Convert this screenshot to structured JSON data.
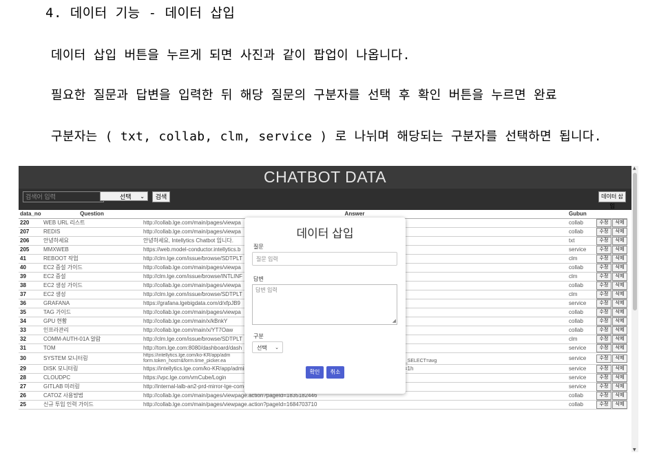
{
  "doc": {
    "heading": "4. 데이터 기능 - 데이터 삽입",
    "lines": [
      "데이터 삽입 버튼을 누르게 되면 사진과 같이 팝업이 나옵니다.",
      "필요한 질문과 답변을 입력한 뒤 해당 질문의 구분자를 선택 후 확인 버튼을 누르면 완료",
      "구분자는 ( txt, collab, clm, service ) 로 나뉘며 해당되는 구분자를 선택하면 됩니다."
    ]
  },
  "app": {
    "title": "CHATBOT DATA",
    "search_placeholder": "검색어 입력",
    "select_value": "선택",
    "search_button": "검색",
    "insert_button": "데이터 삽입"
  },
  "table": {
    "headers": [
      "data_no",
      "Question",
      "Answer",
      "Gubun"
    ],
    "edit_label": "수정",
    "delete_label": "삭제",
    "rows": [
      {
        "no": "220",
        "q": "WEB URL 리스트",
        "a": "http://collab.lge.com/main/pages/viewpa",
        "g": "collab"
      },
      {
        "no": "207",
        "q": "REDIS",
        "a": "http://collab.lge.com/main/pages/viewpa",
        "g": "collab"
      },
      {
        "no": "206",
        "q": "안녕하세요",
        "a": "안녕하세요, Intellytics Chatbot 입니다.",
        "g": "txt"
      },
      {
        "no": "205",
        "q": "MMXWEB",
        "a": "https://web.model-conductor.intellytics.b",
        "g": "service"
      },
      {
        "no": "41",
        "q": "REBOOT 작업",
        "a": "http://clm.lge.com/issue/browse/SDTPLT",
        "g": "clm"
      },
      {
        "no": "40",
        "q": "EC2 증설 가이드",
        "a": "http://collab.lge.com/main/pages/viewpa",
        "g": "collab"
      },
      {
        "no": "39",
        "q": "EC2 증설",
        "a": "http://clm.lge.com/issue/browse/INTLINF",
        "g": "clm"
      },
      {
        "no": "38",
        "q": "EC2 생성 가이드",
        "a": "http://collab.lge.com/main/pages/viewpa",
        "g": "collab"
      },
      {
        "no": "37",
        "q": "EC2 생성",
        "a": "http://clm.lge.com/issue/browse/SDTPLT",
        "g": "clm"
      },
      {
        "no": "36",
        "q": "GRAFANA",
        "a": "https://grafana.lgebigdata.com/d/xfpJB9",
        "g": "service"
      },
      {
        "no": "35",
        "q": "TAG 가이드",
        "a": "http://collab.lge.com/main/pages/viewpa",
        "g": "collab"
      },
      {
        "no": "34",
        "q": "GPU 현황",
        "a": "http://collab.lge.com/main/x/kBnkY",
        "g": "collab"
      },
      {
        "no": "33",
        "q": "인프라관리",
        "a": "http://collab.lge.com/main/x/YT7Oaw",
        "g": "collab"
      },
      {
        "no": "32",
        "q": "COMM-AUTH-01A 알람",
        "a": "http://clm.lge.com/issue/browse/SDTPLT",
        "g": "clm"
      },
      {
        "no": "31",
        "q": "TOM",
        "a": "http://tom.lge.com:8080/dashboard/dash",
        "g": "service"
      },
      {
        "no": "30",
        "q": "SYSTEM 모니터링",
        "a": "https://intellytics.lge.com/ko-KR/app/adm",
        "a2": "form.token_host=&form.time_picker.ea",
        "a3": "m&form.MAX_AVG_SELECT=avg",
        "g": "service"
      },
      {
        "no": "29",
        "q": "DISK 모니터링",
        "a": "https://intellytics.lge.com/ko-KR/app/admin/disk_overview?earliest=-10d%40d&latest=now&form.time_span=1h",
        "g": "service"
      },
      {
        "no": "28",
        "q": "CLOUDPC",
        "a": "https://vpc.lge.com/vmCube/Login",
        "g": "service"
      },
      {
        "no": "27",
        "q": "GITLAB 미러링",
        "a": "http://internal-lalb-an2-prd-mirror-lge-com-733281738.ap-northeast-2.elb.amazonaws.com/",
        "g": "service"
      },
      {
        "no": "26",
        "q": "CATOZ 사용방법",
        "a": "http://collab.lge.com/main/pages/viewpage.action?pageId=1835182446",
        "g": "collab"
      },
      {
        "no": "25",
        "q": "신규 투입 인력 가이드",
        "a": "http://collab.lge.com/main/pages/viewpage.action?pageId=1684703710",
        "g": "collab"
      }
    ]
  },
  "modal": {
    "title": "데이터 삽입",
    "question_label": "질문",
    "question_placeholder": "질문 입력",
    "answer_label": "답변",
    "answer_placeholder": "답변 입력",
    "gubun_label": "구분",
    "gubun_value": "선택",
    "ok_button": "확인",
    "cancel_button": "취소"
  }
}
